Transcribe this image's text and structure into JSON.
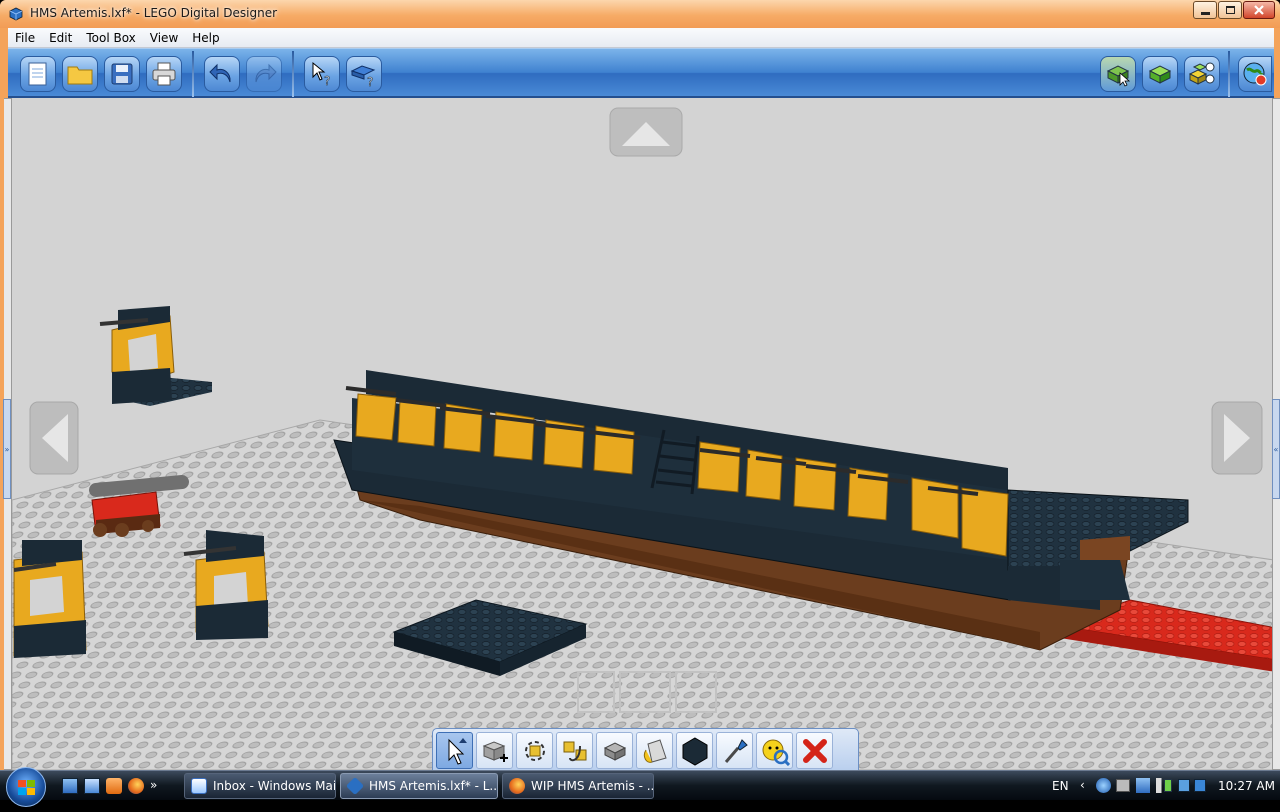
{
  "window": {
    "title": "HMS Artemis.lxf* - LEGO Digital Designer",
    "min_label": "—",
    "max_label": "▢",
    "close_label": "✕"
  },
  "menu": {
    "items": [
      "File",
      "Edit",
      "Tool Box",
      "View",
      "Help"
    ]
  },
  "toolbar": {
    "left_icons": [
      "new-file-icon",
      "open-folder-icon",
      "save-disk-icon",
      "print-icon",
      "undo-icon",
      "redo-icon",
      "select-help-icon",
      "brick-help-icon"
    ],
    "right_icons": [
      "build-mode-icon",
      "view-mode-icon",
      "building-guide-icon",
      "web-upload-icon"
    ]
  },
  "bottom_tools": {
    "icons": [
      "select-arrow-icon",
      "clone-icon",
      "hinge-icon",
      "hinge-align-icon",
      "flex-icon",
      "paint-bucket-icon",
      "color-swatch-icon",
      "eyedropper-icon",
      "hide-icon",
      "delete-icon"
    ],
    "active_index": 0
  },
  "taskbar": {
    "tasks": [
      {
        "label": "Inbox - Windows Mail",
        "icon": "windows-mail-icon",
        "active": false
      },
      {
        "label": "HMS Artemis.lxf* - L...",
        "icon": "lego-designer-icon",
        "active": true
      },
      {
        "label": "WIP HMS Artemis - ...",
        "icon": "firefox-icon",
        "active": false
      }
    ],
    "quicklaunch_more": "»",
    "language": "EN",
    "clock": "10:27 AM"
  },
  "colors": {
    "title_orange": "#f4a35a",
    "toolbar_blue": "#3f82d0",
    "viewport_gray": "#d3d3d3",
    "brick_yellow": "#e8a91f",
    "brick_dark": "#1b2a36",
    "brick_brown": "#6b3d1e",
    "brick_red": "#d9291c"
  }
}
